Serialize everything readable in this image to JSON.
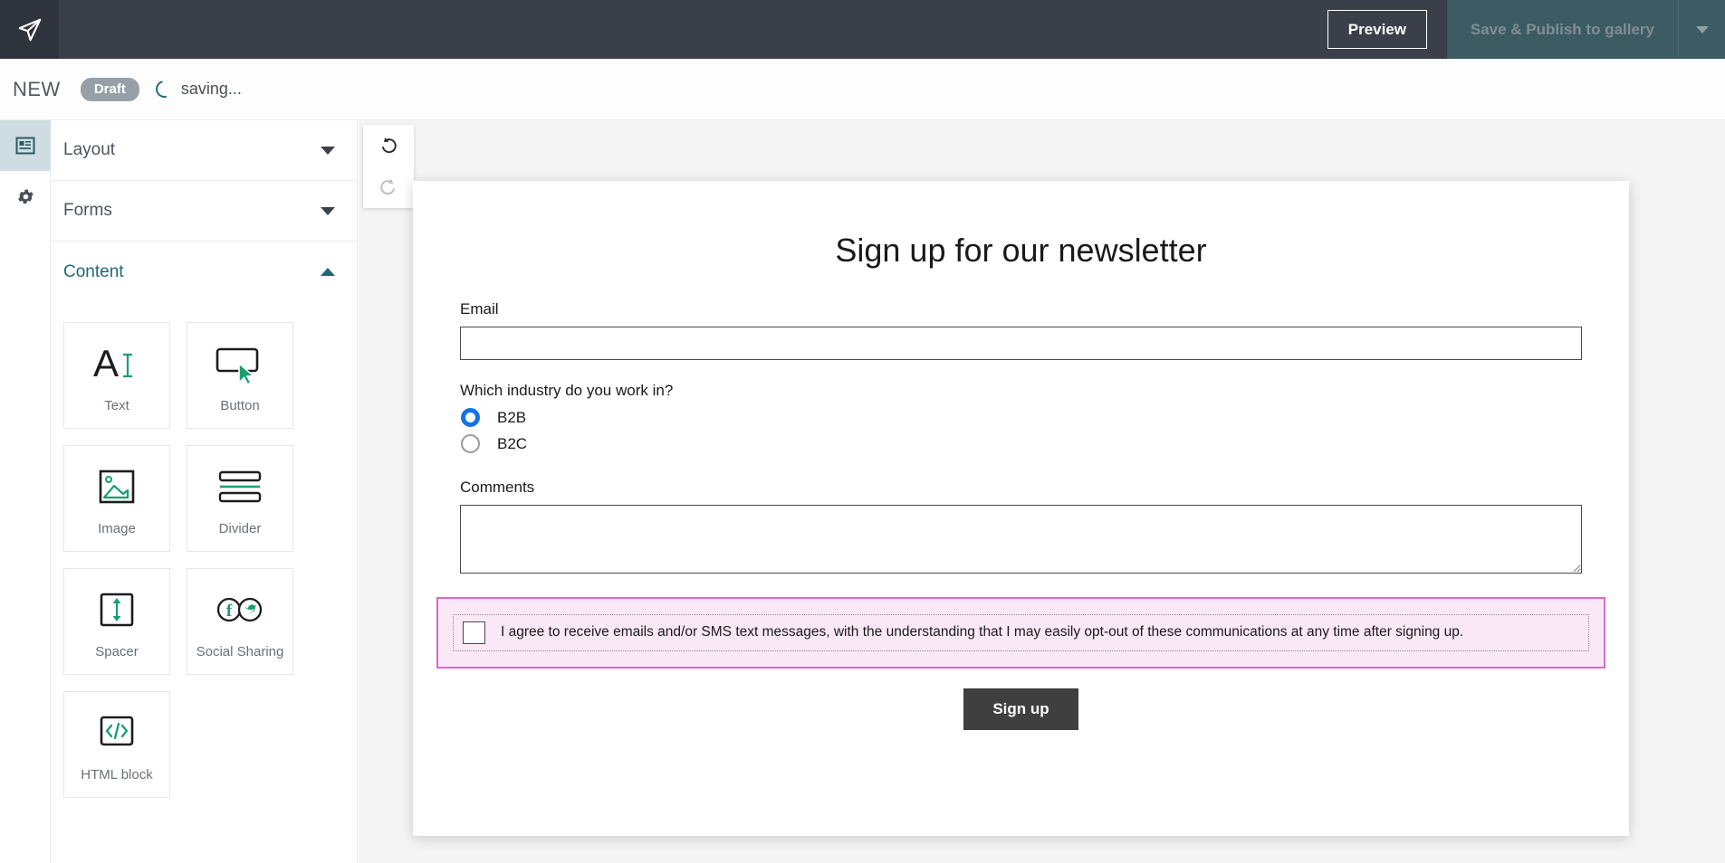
{
  "topbar": {
    "logo_icon": "paper-plane-icon",
    "preview_label": "Preview",
    "publish_label": "Save & Publish to gallery",
    "publish_caret_icon": "chevron-down-icon"
  },
  "docbar": {
    "title": "NEW",
    "status_badge": "Draft",
    "saving_text": "saving...",
    "spinner_icon": "loading-spinner-icon"
  },
  "rail": {
    "items": [
      {
        "name": "blocks",
        "icon": "content-blocks-icon",
        "active": true
      },
      {
        "name": "settings",
        "icon": "gear-icon",
        "active": false
      }
    ]
  },
  "sidebar": {
    "sections": [
      {
        "title": "Layout",
        "expanded": false,
        "chevron": "chevron-down-icon"
      },
      {
        "title": "Forms",
        "expanded": false,
        "chevron": "chevron-down-icon"
      },
      {
        "title": "Content",
        "expanded": true,
        "chevron": "chevron-up-icon"
      }
    ],
    "content_tiles": [
      {
        "label": "Text",
        "icon": "text-a-cursor-icon"
      },
      {
        "label": "Button",
        "icon": "button-pointer-icon"
      },
      {
        "label": "Image",
        "icon": "image-picture-icon"
      },
      {
        "label": "Divider",
        "icon": "divider-lines-icon"
      },
      {
        "label": "Spacer",
        "icon": "spacer-arrows-icon"
      },
      {
        "label": "Social Sharing",
        "icon": "social-share-icon"
      },
      {
        "label": "HTML block",
        "icon": "code-brackets-icon"
      }
    ]
  },
  "canvas": {
    "undo_icon": "undo-arrow-icon",
    "redo_icon": "redo-arrow-icon",
    "undo_enabled": true,
    "redo_enabled": false
  },
  "email": {
    "title": "Sign up for our newsletter",
    "email_label": "Email",
    "email_value": "",
    "email_placeholder": "",
    "industry_question": "Which industry do you work in?",
    "industry_options": [
      {
        "label": "B2B",
        "selected": true
      },
      {
        "label": "B2C",
        "selected": false
      }
    ],
    "comments_label": "Comments",
    "comments_value": "",
    "comments_placeholder": "",
    "consent_text": "I agree to receive emails and/or SMS text messages, with the understanding that I may easily opt-out of these communications at any time after signing up.",
    "consent_checked": false,
    "submit_label": "Sign up"
  },
  "colors": {
    "topbar_bg": "#3b3f4a",
    "accent_teal": "#1e6b73",
    "tile_icon_green": "#16a06e",
    "radio_blue": "#1273e6",
    "consent_border": "#d86ac8",
    "consent_bg": "#fbe8f7",
    "submit_bg": "#3f3f3f"
  }
}
